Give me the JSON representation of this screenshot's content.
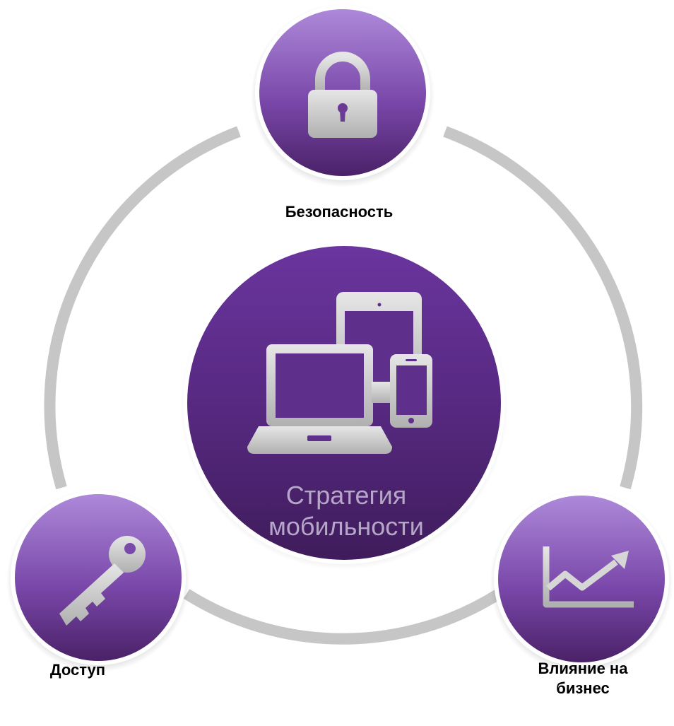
{
  "diagram": {
    "center": {
      "line1": "Стратегия",
      "line2": "мобильности"
    },
    "nodes": {
      "security": {
        "label": "Безопасность",
        "icon": "lock-icon"
      },
      "access": {
        "label": "Доступ",
        "icon": "key-icon"
      },
      "business": {
        "label_line1": "Влияние на",
        "label_line2": "бизнес",
        "icon": "growth-chart-icon"
      }
    },
    "center_icon": "devices-icon",
    "colors": {
      "purple_top": "#a37ccf",
      "purple_dark": "#4a2168",
      "ring": "#c4c4c4",
      "icon": "#c8c8c8"
    }
  }
}
